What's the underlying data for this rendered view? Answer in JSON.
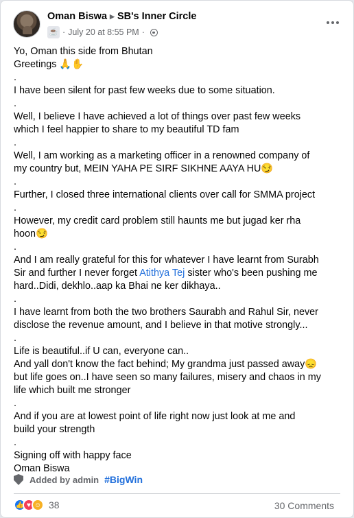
{
  "post": {
    "author": "Oman Biswa",
    "group": "SB's Inner Circle",
    "date": "July 20 at 8:55 PM",
    "dot": "·",
    "mention": "Atithya Tej",
    "lines_before_mention": "Yo, Oman this side from Bhutan\nGreetings 🙏✋\n.\nI have been silent for past few weeks due to some situation.\n.\nWell, I believe I have achieved a lot of things over past few weeks\nwhich I feel happier to share to my beautiful TD fam\n.\nWell, I am working as a marketing officer in a renowned company of\nmy country but, MEIN YAHA PE SIRF SIKHNE AAYA HU😏\n.\nFurther, I closed three international clients over call for SMMA project\n.\nHowever, my credit card problem still haunts me but jugad ker rha\nhoon😏\n.\nAnd I am really grateful for this for whatever I have learnt from Surabh\nSir and further I never forget ",
    "lines_after_mention": " sister who's been pushing me\nhard..Didi, dekhlo..aap ka Bhai ne ker dikhaya..\n.\nI have learnt from both the two brothers Saurabh and Rahul Sir, never\ndisclose the revenue amount, and I believe in that motive strongly...\n.\nLife is beautiful..if U can, everyone can..\nAnd yall don't know the fact behind; My grandma just passed away😞\nbut life goes on..I have seen so many failures, misery and chaos in my\nlife which built me stronger\n.\nAnd if you are at lowest point of life right now just look at me and\nbuild your strength\n.\nSigning off with happy face\nOman Biswa"
  },
  "footer": {
    "added_by": "Added by admin",
    "hashtag": "#BigWin",
    "reaction_count": "38",
    "comments": "30 Comments"
  },
  "icons": {
    "privacy": "globe-icon",
    "badge": "shield-icon",
    "reactions": [
      "like-icon",
      "love-icon",
      "care-icon"
    ]
  },
  "colors": {
    "link": "#216fdb",
    "secondary_text": "#65676b",
    "like": "#1877f2",
    "love": "#f33e58",
    "care": "#f7b125"
  }
}
